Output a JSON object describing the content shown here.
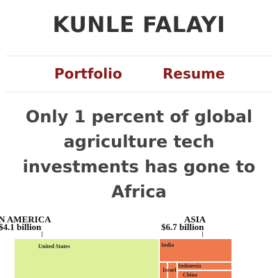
{
  "site": {
    "title": "KUNLE FALAYI"
  },
  "nav": {
    "items": [
      {
        "label": "Portfolio"
      },
      {
        "label": "Resume"
      }
    ],
    "link_color": "#8b1a1a"
  },
  "article": {
    "headline": "Only 1 percent of global agriculture tech investments has gone to Africa"
  },
  "chart_data": {
    "type": "treemap",
    "regions": [
      {
        "name": "N AMERICA",
        "total_label": "$4.1 billion",
        "color": "#dff09a"
      },
      {
        "name": "ASIA",
        "total_label": "$6.7 billion",
        "color": "#f07a4e"
      }
    ],
    "tiles": [
      {
        "label": "United States",
        "region": "N AMERICA"
      },
      {
        "label": "India",
        "region": "ASIA"
      },
      {
        "label": "Israel",
        "region": "ASIA"
      },
      {
        "label": "Indonesia",
        "region": "ASIA"
      },
      {
        "label": "China",
        "region": "ASIA"
      }
    ]
  }
}
